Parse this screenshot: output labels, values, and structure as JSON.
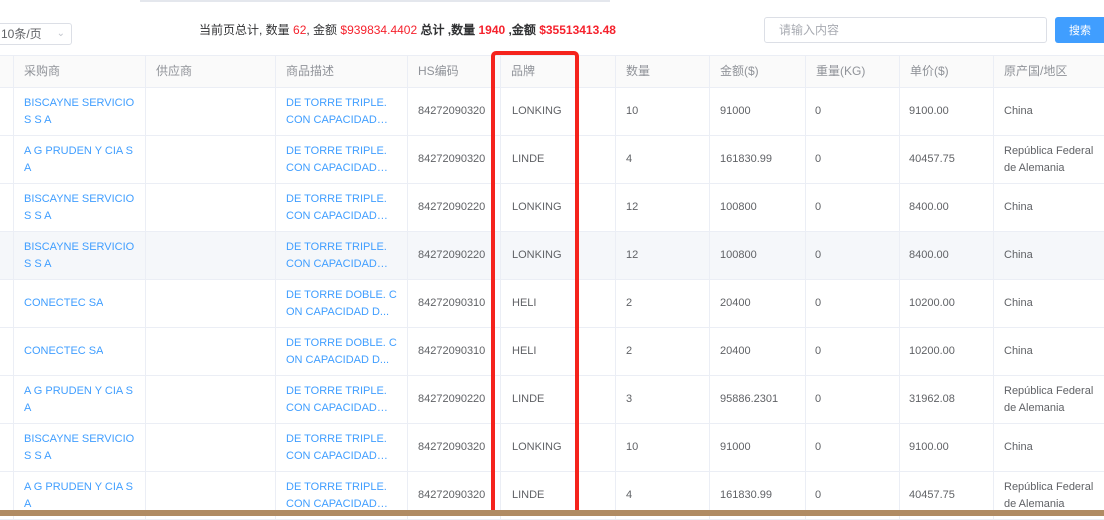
{
  "pagination": {
    "page_size": "10条/页"
  },
  "summary": {
    "page_label": "当前页总计, 数量 ",
    "page_qty": "62",
    "amount_label": ", 金额 ",
    "page_amount": "$939834.4402",
    "total_label": " 总计 ,数量 ",
    "total_qty": "1940",
    "total_amount_label": " ,金额 ",
    "total_amount": "$35513413.48"
  },
  "search": {
    "placeholder": "请输入内容",
    "button": "搜索"
  },
  "table": {
    "headers": {
      "buyer": "采购商",
      "supplier": "供应商",
      "description": "商品描述",
      "hs": "HS编码",
      "brand": "品牌",
      "qty": "数量",
      "amount": "金额($)",
      "weight": "重量(KG)",
      "unit_price": "单价($)",
      "origin": "原产国/地区"
    },
    "rows": [
      {
        "buyer": "BISCAYNE SERVICIOS S A",
        "supplier": "",
        "description": "DE TORRE TRIPLE. CON CAPACIDAD D...",
        "hs": "84272090320",
        "brand": "LONKING",
        "qty": "10",
        "amount": "91000",
        "weight": "0",
        "unit_price": "9100.00",
        "origin": "China"
      },
      {
        "buyer": "A G PRUDEN Y CIA S A",
        "supplier": "",
        "description": "DE TORRE TRIPLE. CON CAPACIDAD D...",
        "hs": "84272090320",
        "brand": "LINDE",
        "qty": "4",
        "amount": "161830.99",
        "weight": "0",
        "unit_price": "40457.75",
        "origin": "República Federal de Alemania"
      },
      {
        "buyer": "BISCAYNE SERVICIOS S A",
        "supplier": "",
        "description": "DE TORRE TRIPLE. CON CAPACIDAD D...",
        "hs": "84272090220",
        "brand": "LONKING",
        "qty": "12",
        "amount": "100800",
        "weight": "0",
        "unit_price": "8400.00",
        "origin": "China"
      },
      {
        "buyer": "BISCAYNE SERVICIOS S A",
        "supplier": "",
        "description": "DE TORRE TRIPLE. CON CAPACIDAD D...",
        "hs": "84272090220",
        "brand": "LONKING",
        "qty": "12",
        "amount": "100800",
        "weight": "0",
        "unit_price": "8400.00",
        "origin": "China"
      },
      {
        "buyer": "CONECTEC SA",
        "supplier": "",
        "description": "DE TORRE DOBLE. CON CAPACIDAD D...",
        "hs": "84272090310",
        "brand": "HELI",
        "qty": "2",
        "amount": "20400",
        "weight": "0",
        "unit_price": "10200.00",
        "origin": "China"
      },
      {
        "buyer": "CONECTEC SA",
        "supplier": "",
        "description": "DE TORRE DOBLE. CON CAPACIDAD D...",
        "hs": "84272090310",
        "brand": "HELI",
        "qty": "2",
        "amount": "20400",
        "weight": "0",
        "unit_price": "10200.00",
        "origin": "China"
      },
      {
        "buyer": "A G PRUDEN Y CIA S A",
        "supplier": "",
        "description": "DE TORRE TRIPLE. CON CAPACIDAD D...",
        "hs": "84272090220",
        "brand": "LINDE",
        "qty": "3",
        "amount": "95886.2301",
        "weight": "0",
        "unit_price": "31962.08",
        "origin": "República Federal de Alemania"
      },
      {
        "buyer": "BISCAYNE SERVICIOS S A",
        "supplier": "",
        "description": "DE TORRE TRIPLE. CON CAPACIDAD D...",
        "hs": "84272090320",
        "brand": "LONKING",
        "qty": "10",
        "amount": "91000",
        "weight": "0",
        "unit_price": "9100.00",
        "origin": "China"
      },
      {
        "buyer": "A G PRUDEN Y CIA S A",
        "supplier": "",
        "description": "DE TORRE TRIPLE. CON CAPACIDAD D...",
        "hs": "84272090320",
        "brand": "LINDE",
        "qty": "4",
        "amount": "161830.99",
        "weight": "0",
        "unit_price": "40457.75",
        "origin": "República Federal de Alemania"
      }
    ]
  },
  "colors": {
    "link": "#409eff",
    "highlight": "#f5231c",
    "accent_red": "#f5222d",
    "button": "#409eff"
  }
}
